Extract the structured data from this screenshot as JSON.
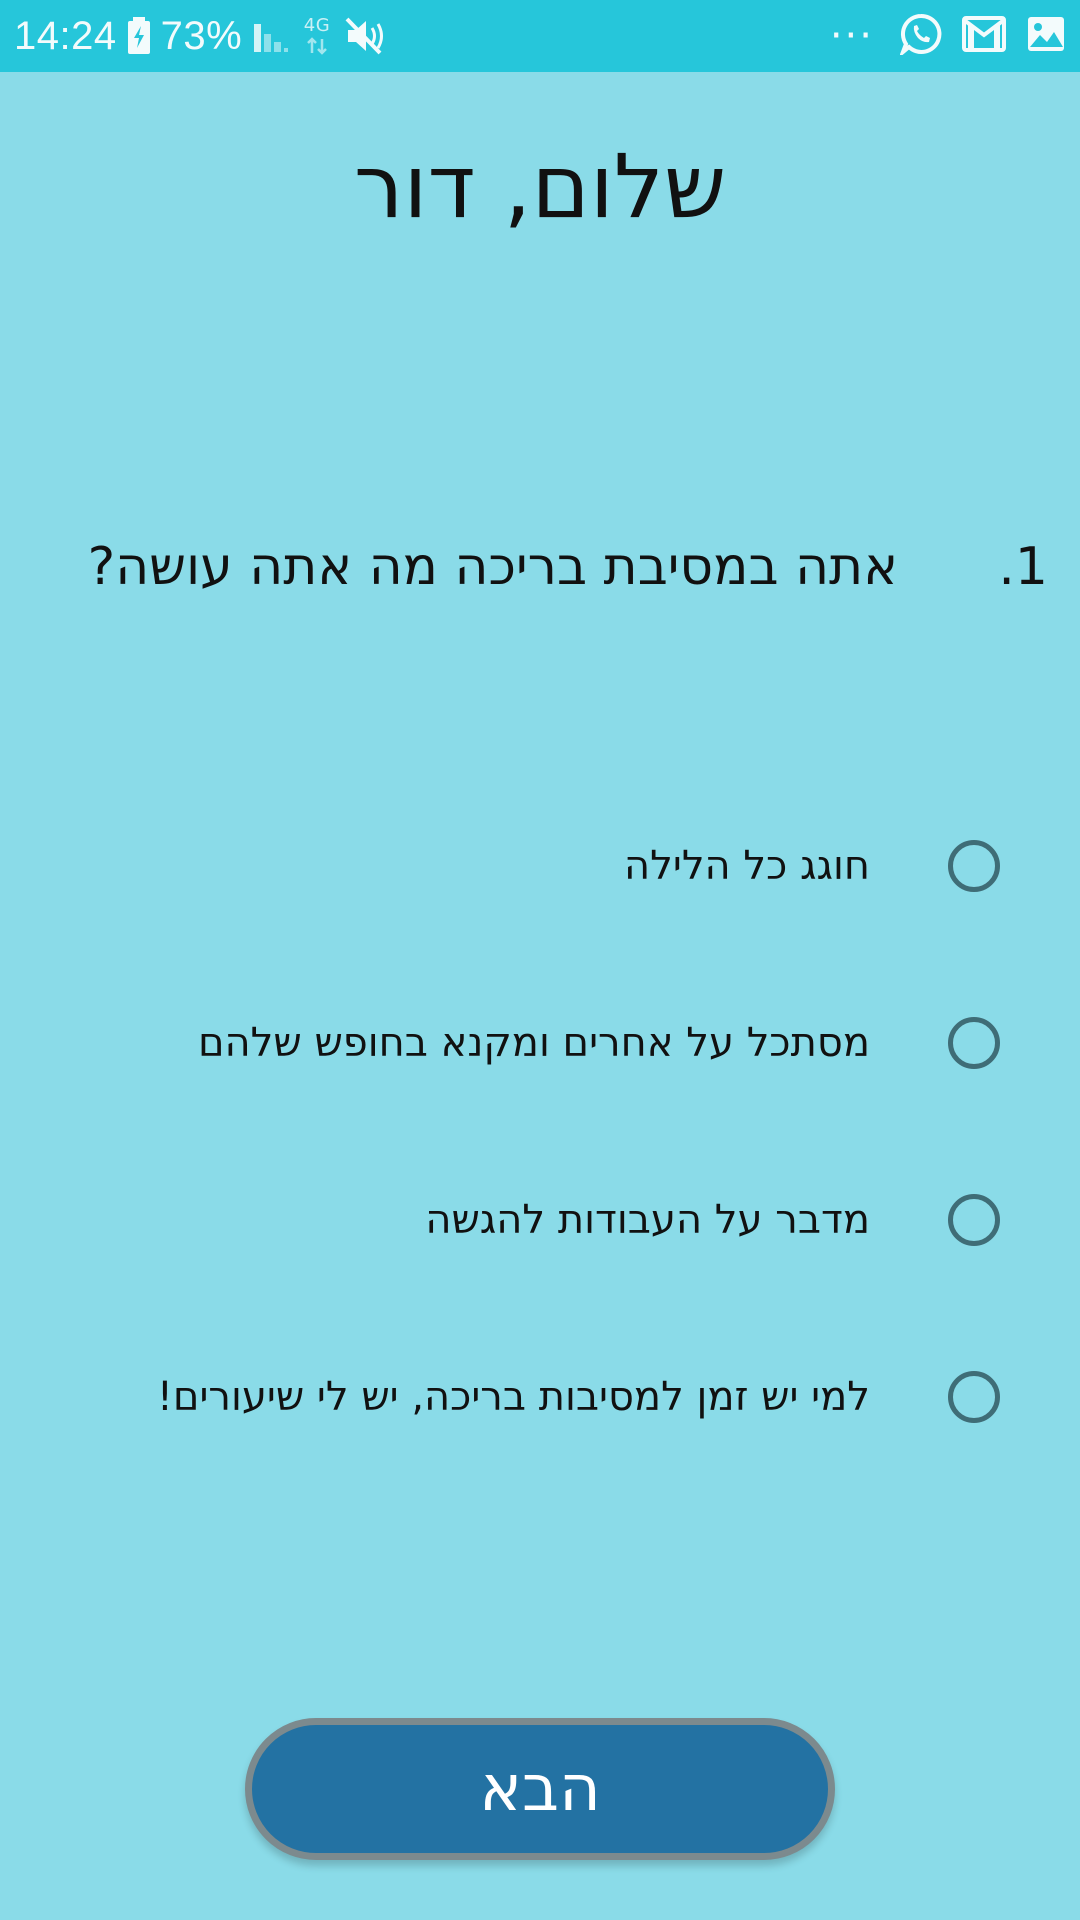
{
  "status_bar": {
    "time": "14:24",
    "battery": "73%",
    "network": "4G",
    "more": "···",
    "icons": [
      "battery-charging-icon",
      "signal-icon",
      "network-4g-icon",
      "mute-icon",
      "whatsapp-icon",
      "gmail-icon",
      "gallery-icon"
    ]
  },
  "header": {
    "greeting": "שלום, דור"
  },
  "question": {
    "number": "1.",
    "text": "אתה במסיבת בריכה מה אתה עושה?"
  },
  "options": [
    {
      "label": "חוגג כל הלילה",
      "selected": false
    },
    {
      "label": "מסתכל על אחרים ומקנא בחופש שלהם",
      "selected": false
    },
    {
      "label": "מדבר על העבודות להגשה",
      "selected": false
    },
    {
      "label": "למי יש זמן למסיבות בריכה, יש לי שיעורים!",
      "selected": false
    }
  ],
  "next_button": {
    "label": "הבא"
  },
  "colors": {
    "background": "#8adbe8",
    "status_bar": "#26c6da",
    "button": "#2372a3",
    "radio_border": "#3f6d77"
  }
}
